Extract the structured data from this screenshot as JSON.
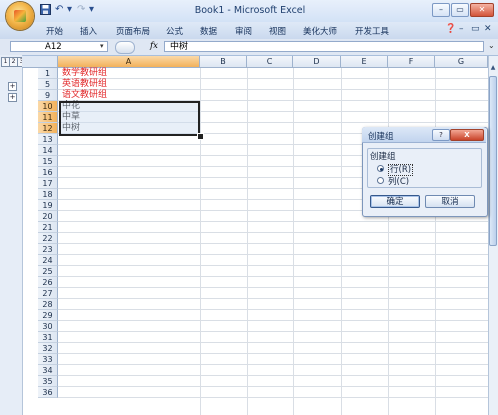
{
  "window": {
    "title": "Book1 - Microsoft Excel",
    "min": "–",
    "restore": "▭",
    "close": "✕"
  },
  "qat": {
    "save_icon": "save-icon",
    "undo": "↶",
    "redo": "↷",
    "more": "▾"
  },
  "ribbon": {
    "tabs": [
      "开始",
      "插入",
      "页面布局",
      "公式",
      "数据",
      "审阅",
      "视图",
      "美化大师",
      "开发工具"
    ],
    "help": "❓",
    "ribbon_min": "–",
    "ribbon_restore": "▭",
    "ribbon_close": "✕"
  },
  "formula": {
    "name_box": "A12",
    "fx": "fx",
    "value": "中树",
    "dropdown": "▾",
    "expand": "⌄"
  },
  "outline": {
    "levels": [
      "1",
      "2",
      "3"
    ],
    "expand": "+"
  },
  "grid": {
    "columns": [
      "A",
      "B",
      "C",
      "D",
      "E",
      "F",
      "G"
    ],
    "rows": [
      {
        "num": "1",
        "text": "数学教研组",
        "red": true
      },
      {
        "num": "5",
        "text": "英语教研组",
        "red": true
      },
      {
        "num": "9",
        "text": "语文教研组",
        "red": true
      },
      {
        "num": "10",
        "text": "中花",
        "red": false
      },
      {
        "num": "11",
        "text": "中草",
        "red": false
      },
      {
        "num": "12",
        "text": "中树",
        "red": false
      },
      {
        "num": "13",
        "text": ""
      },
      {
        "num": "14",
        "text": ""
      },
      {
        "num": "15",
        "text": ""
      },
      {
        "num": "16",
        "text": ""
      },
      {
        "num": "17",
        "text": ""
      },
      {
        "num": "18",
        "text": ""
      },
      {
        "num": "19",
        "text": ""
      },
      {
        "num": "20",
        "text": ""
      },
      {
        "num": "21",
        "text": ""
      },
      {
        "num": "22",
        "text": ""
      },
      {
        "num": "23",
        "text": ""
      },
      {
        "num": "24",
        "text": ""
      },
      {
        "num": "25",
        "text": ""
      },
      {
        "num": "26",
        "text": ""
      },
      {
        "num": "27",
        "text": ""
      },
      {
        "num": "28",
        "text": ""
      },
      {
        "num": "29",
        "text": ""
      },
      {
        "num": "30",
        "text": ""
      },
      {
        "num": "31",
        "text": ""
      },
      {
        "num": "32",
        "text": ""
      },
      {
        "num": "33",
        "text": ""
      },
      {
        "num": "34",
        "text": ""
      },
      {
        "num": "35",
        "text": ""
      },
      {
        "num": "36",
        "text": ""
      }
    ]
  },
  "dialog": {
    "title": "创建组",
    "help": "?",
    "close": "X",
    "group_label": "创建组",
    "option_row": "行(R)",
    "option_col": "列(C)",
    "ok": "确定",
    "cancel": "取消"
  },
  "colors": {
    "red_text": "#e2292b",
    "selected_header": "#f2b15a"
  }
}
